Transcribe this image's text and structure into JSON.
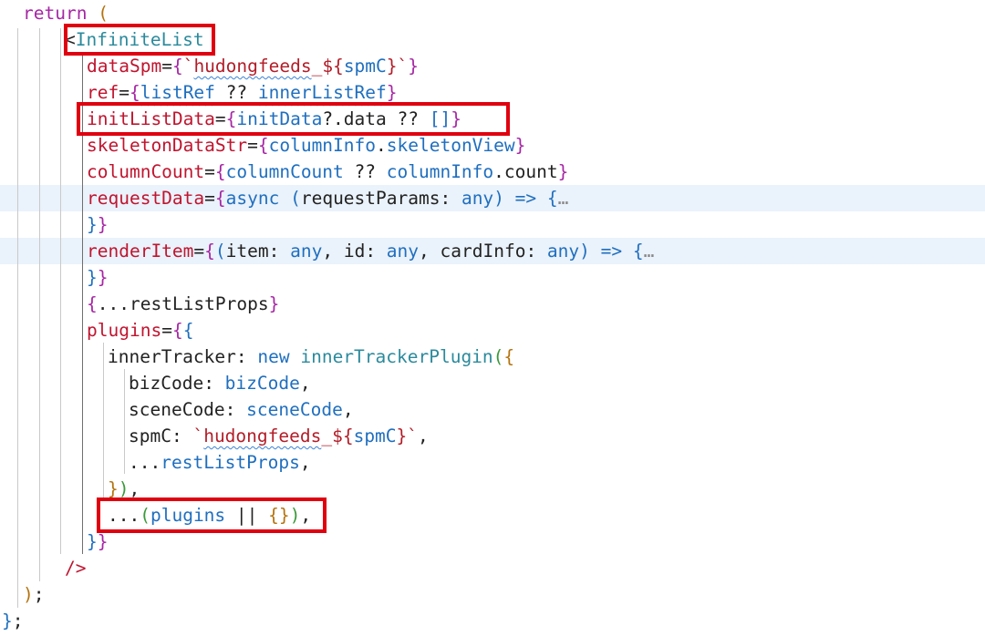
{
  "editor": {
    "language": "tsx",
    "lines": [
      {
        "indent": 1,
        "tokens": [
          {
            "t": "return",
            "c": "t-kw"
          },
          {
            "t": " ",
            "c": "t-plain"
          },
          {
            "t": "(",
            "c": "b1"
          }
        ]
      },
      {
        "indent": 3,
        "tokens": [
          {
            "t": "<",
            "c": "t-plain"
          },
          {
            "t": "InfiniteList",
            "c": "t-tag"
          }
        ]
      },
      {
        "indent": 4,
        "tokens": [
          {
            "t": "dataSpm",
            "c": "t-attr"
          },
          {
            "t": "=",
            "c": "t-plain"
          },
          {
            "t": "{",
            "c": "b2"
          },
          {
            "t": "`",
            "c": "t-str"
          },
          {
            "t": "hudongfeeds",
            "c": "t-str t-sq"
          },
          {
            "t": "_${",
            "c": "t-str"
          },
          {
            "t": "spmC",
            "c": "t-var"
          },
          {
            "t": "}`",
            "c": "t-str"
          },
          {
            "t": "}",
            "c": "b2"
          }
        ]
      },
      {
        "indent": 4,
        "tokens": [
          {
            "t": "ref",
            "c": "t-attr"
          },
          {
            "t": "=",
            "c": "t-plain"
          },
          {
            "t": "{",
            "c": "b2"
          },
          {
            "t": "listRef",
            "c": "t-var t-sq"
          },
          {
            "t": " ?? ",
            "c": "t-plain"
          },
          {
            "t": "innerListRef",
            "c": "t-var t-sq"
          },
          {
            "t": "}",
            "c": "b2"
          }
        ]
      },
      {
        "indent": 4,
        "tokens": [
          {
            "t": "initListData",
            "c": "t-attr"
          },
          {
            "t": "=",
            "c": "t-plain"
          },
          {
            "t": "{",
            "c": "b2"
          },
          {
            "t": "initData",
            "c": "t-var"
          },
          {
            "t": "?.data ?? ",
            "c": "t-plain"
          },
          {
            "t": "[]",
            "c": "b3"
          },
          {
            "t": "}",
            "c": "b2"
          }
        ]
      },
      {
        "indent": 4,
        "tokens": [
          {
            "t": "skeletonDataStr",
            "c": "t-attr"
          },
          {
            "t": "=",
            "c": "t-plain"
          },
          {
            "t": "{",
            "c": "b2"
          },
          {
            "t": "columnInfo",
            "c": "t-var"
          },
          {
            "t": ".",
            "c": "t-plain"
          },
          {
            "t": "skeletonView",
            "c": "t-var"
          },
          {
            "t": "}",
            "c": "b2"
          }
        ]
      },
      {
        "indent": 4,
        "tokens": [
          {
            "t": "columnCount",
            "c": "t-attr"
          },
          {
            "t": "=",
            "c": "t-plain"
          },
          {
            "t": "{",
            "c": "b2"
          },
          {
            "t": "columnCount",
            "c": "t-var"
          },
          {
            "t": " ?? ",
            "c": "t-plain"
          },
          {
            "t": "columnInfo",
            "c": "t-var"
          },
          {
            "t": ".count",
            "c": "t-plain"
          },
          {
            "t": "}",
            "c": "b2"
          }
        ]
      },
      {
        "indent": 4,
        "hl": true,
        "tokens": [
          {
            "t": "requestData",
            "c": "t-attr"
          },
          {
            "t": "=",
            "c": "t-plain"
          },
          {
            "t": "{",
            "c": "b2"
          },
          {
            "t": "async ",
            "c": "t-var"
          },
          {
            "t": "(",
            "c": "b3"
          },
          {
            "t": "requestParams",
            "c": "t-plain"
          },
          {
            "t": ": ",
            "c": "t-plain"
          },
          {
            "t": "any",
            "c": "t-var"
          },
          {
            "t": ")",
            "c": "b3"
          },
          {
            "t": " => ",
            "c": "t-var"
          },
          {
            "t": "{",
            "c": "b3"
          },
          {
            "t": "…",
            "c": "t-ell"
          }
        ]
      },
      {
        "indent": 4,
        "tokens": [
          {
            "t": "}",
            "c": "b3"
          },
          {
            "t": "}",
            "c": "b2"
          }
        ]
      },
      {
        "indent": 4,
        "hl": true,
        "tokens": [
          {
            "t": "renderItem",
            "c": "t-attr"
          },
          {
            "t": "=",
            "c": "t-plain"
          },
          {
            "t": "{",
            "c": "b2"
          },
          {
            "t": "(",
            "c": "b3"
          },
          {
            "t": "item",
            "c": "t-plain"
          },
          {
            "t": ": ",
            "c": "t-plain"
          },
          {
            "t": "any",
            "c": "t-var"
          },
          {
            "t": ", ",
            "c": "t-plain"
          },
          {
            "t": "id",
            "c": "t-plain"
          },
          {
            "t": ": ",
            "c": "t-plain"
          },
          {
            "t": "any",
            "c": "t-var"
          },
          {
            "t": ", ",
            "c": "t-plain"
          },
          {
            "t": "cardInfo",
            "c": "t-plain"
          },
          {
            "t": ": ",
            "c": "t-plain"
          },
          {
            "t": "any",
            "c": "t-var"
          },
          {
            "t": ")",
            "c": "b3"
          },
          {
            "t": " => ",
            "c": "t-var"
          },
          {
            "t": "{",
            "c": "b3"
          },
          {
            "t": "…",
            "c": "t-ell"
          }
        ]
      },
      {
        "indent": 4,
        "tokens": [
          {
            "t": "}",
            "c": "b3"
          },
          {
            "t": "}",
            "c": "b2"
          }
        ]
      },
      {
        "indent": 4,
        "tokens": [
          {
            "t": "{",
            "c": "b2"
          },
          {
            "t": "...restListProps",
            "c": "t-plain"
          },
          {
            "t": "}",
            "c": "b2"
          }
        ]
      },
      {
        "indent": 4,
        "tokens": [
          {
            "t": "plugins",
            "c": "t-attr"
          },
          {
            "t": "=",
            "c": "t-plain"
          },
          {
            "t": "{",
            "c": "b2"
          },
          {
            "t": "{",
            "c": "b3"
          }
        ]
      },
      {
        "indent": 5,
        "tokens": [
          {
            "t": "innerTracker",
            "c": "t-plain"
          },
          {
            "t": ": ",
            "c": "t-plain"
          },
          {
            "t": "new ",
            "c": "t-var"
          },
          {
            "t": "innerTrackerPlugin",
            "c": "t-tag"
          },
          {
            "t": "(",
            "c": "t-green"
          },
          {
            "t": "{",
            "c": "b1"
          }
        ]
      },
      {
        "indent": 6,
        "tokens": [
          {
            "t": "bizCode",
            "c": "t-plain"
          },
          {
            "t": ": ",
            "c": "t-plain"
          },
          {
            "t": "bizCode",
            "c": "t-var"
          },
          {
            "t": ",",
            "c": "t-plain"
          }
        ]
      },
      {
        "indent": 6,
        "tokens": [
          {
            "t": "sceneCode",
            "c": "t-plain"
          },
          {
            "t": ": ",
            "c": "t-plain"
          },
          {
            "t": "sceneCode",
            "c": "t-var"
          },
          {
            "t": ",",
            "c": "t-plain"
          }
        ]
      },
      {
        "indent": 6,
        "tokens": [
          {
            "t": "spmC",
            "c": "t-plain"
          },
          {
            "t": ": ",
            "c": "t-plain"
          },
          {
            "t": "`",
            "c": "t-str"
          },
          {
            "t": "hudongfeeds",
            "c": "t-str t-sq"
          },
          {
            "t": "_${",
            "c": "t-str"
          },
          {
            "t": "spmC",
            "c": "t-var"
          },
          {
            "t": "}`",
            "c": "t-str"
          },
          {
            "t": ",",
            "c": "t-plain"
          }
        ]
      },
      {
        "indent": 6,
        "tokens": [
          {
            "t": "...",
            "c": "t-plain"
          },
          {
            "t": "restListProps",
            "c": "t-var"
          },
          {
            "t": ",",
            "c": "t-plain"
          }
        ]
      },
      {
        "indent": 5,
        "tokens": [
          {
            "t": "}",
            "c": "b1"
          },
          {
            "t": ")",
            "c": "t-green"
          },
          {
            "t": ",",
            "c": "t-plain"
          }
        ]
      },
      {
        "indent": 5,
        "tokens": [
          {
            "t": "...",
            "c": "t-plain"
          },
          {
            "t": "(",
            "c": "t-green"
          },
          {
            "t": "plugins",
            "c": "t-var"
          },
          {
            "t": " || ",
            "c": "t-plain"
          },
          {
            "t": "{}",
            "c": "b1"
          },
          {
            "t": ")",
            "c": "t-green"
          },
          {
            "t": ",",
            "c": "t-plain"
          }
        ]
      },
      {
        "indent": 4,
        "tokens": [
          {
            "t": "}",
            "c": "b3"
          },
          {
            "t": "}",
            "c": "b2"
          }
        ]
      },
      {
        "indent": 3,
        "tokens": [
          {
            "t": "/>",
            "c": "t-attr"
          }
        ]
      },
      {
        "indent": 1,
        "tokens": [
          {
            "t": ")",
            "c": "b1"
          },
          {
            "t": ";",
            "c": "t-plain"
          }
        ]
      },
      {
        "indent": 0,
        "tokens": [
          {
            "t": "}",
            "c": "b3"
          },
          {
            "t": ";",
            "c": "t-plain"
          }
        ]
      }
    ]
  },
  "highlight_color": "#e0000f"
}
